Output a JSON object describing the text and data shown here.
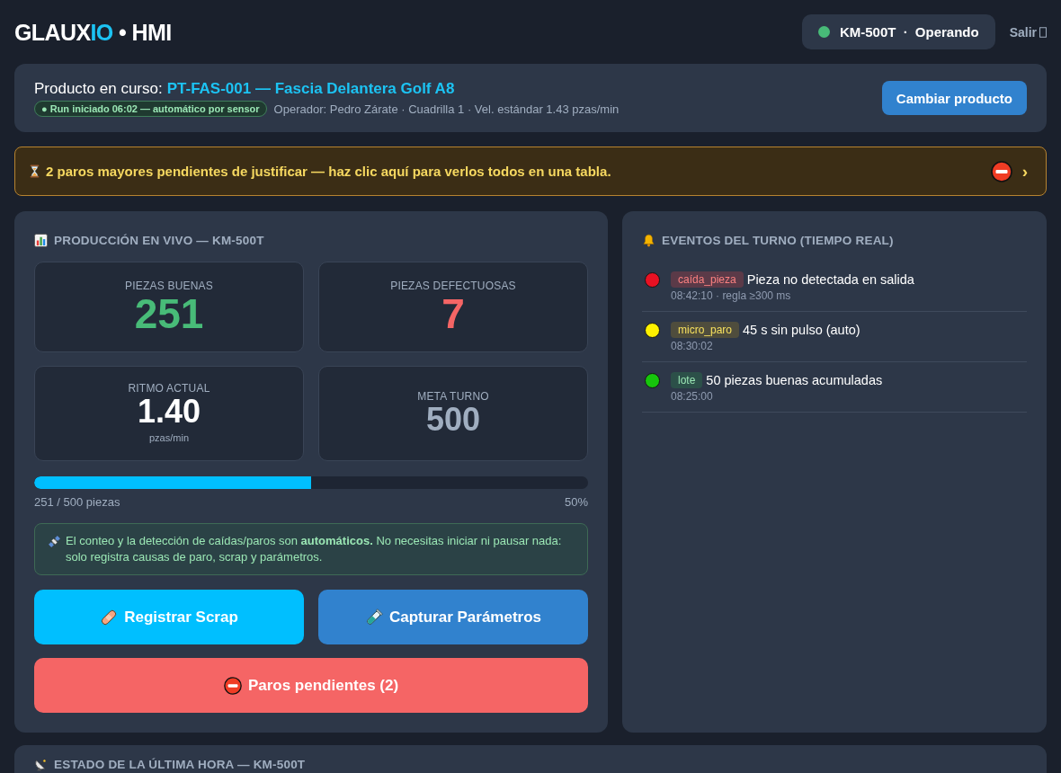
{
  "header": {
    "logo": {
      "name": "GLAUX",
      "accent": "IO",
      "suffix": "• HMI"
    },
    "machine_status": {
      "machine": "KM-500T",
      "separator": "·",
      "state": "Operando",
      "online": true
    },
    "logout": {
      "label": "Salir"
    }
  },
  "product_bar": {
    "label": "Producto en curso:",
    "product": "PT-FAS-001 — Fascia Delantera Golf A8",
    "run_badge": "● Run iniciado 06:02 — automático por sensor",
    "details": "Operador: Pedro Zárate · Cuadrilla 1 · Vel. estándar 1.43 pzas/min",
    "button": "Cambiar producto"
  },
  "alert": {
    "text": "2 paros mayores pendientes de justificar — **haz clic aquí** para verlos todos en una tabla.",
    "chevron": "›"
  },
  "production": {
    "title": "PRODUCCIÓN EN VIVO — KM-500T",
    "stats": [
      {
        "label": "PIEZAS BUENAS",
        "value": "251",
        "kind": "count",
        "color": "#48bb78"
      },
      {
        "label": "PIEZAS DEFECTUOSAS",
        "value": "7",
        "kind": "count",
        "color": "#f56565"
      },
      {
        "label": "RITMO ACTUAL",
        "value": "1.40",
        "unit": "pzas/min",
        "kind": "metric",
        "color": "#ffffff"
      },
      {
        "label": "META TURNO",
        "value": "500",
        "kind": "metric",
        "color": "#a0aec0"
      }
    ],
    "progress": {
      "level": 0.5,
      "caption": "251 / 500 piezas",
      "percent": "50%"
    },
    "info": "El conteo y la detección de caídas/paros son **automáticos.** No necesitas iniciar ni pausar nada: solo registra causas de paro, scrap y parámetros.",
    "buttons": [
      {
        "label": "Registrar Scrap",
        "kind": "scrap"
      },
      {
        "label": "Capturar Parámetros",
        "kind": "params"
      },
      {
        "label": "Paros pendientes (2)",
        "kind": "stops"
      }
    ]
  },
  "events": {
    "title": "EVENTOS DEL TURNO (TIEMPO REAL)",
    "items": [
      {
        "color": "#e81123",
        "kind": "alarm",
        "tag": "caída_pieza",
        "message": "Pieza no detectada en salida",
        "meta": "08:42:10 · regla ≥300 ms"
      },
      {
        "color": "#fff100",
        "kind": "warning",
        "tag": "micro_paro",
        "message": "45 s sin pulso (auto)",
        "meta": "08:30:02"
      },
      {
        "color": "#16c60c",
        "kind": "info",
        "tag": "lote",
        "message": "50 piezas buenas acumuladas",
        "meta": "08:25:00"
      }
    ]
  },
  "last_hour": {
    "title": "ESTADO DE LA ÚLTIMA HORA — KM-500T"
  }
}
